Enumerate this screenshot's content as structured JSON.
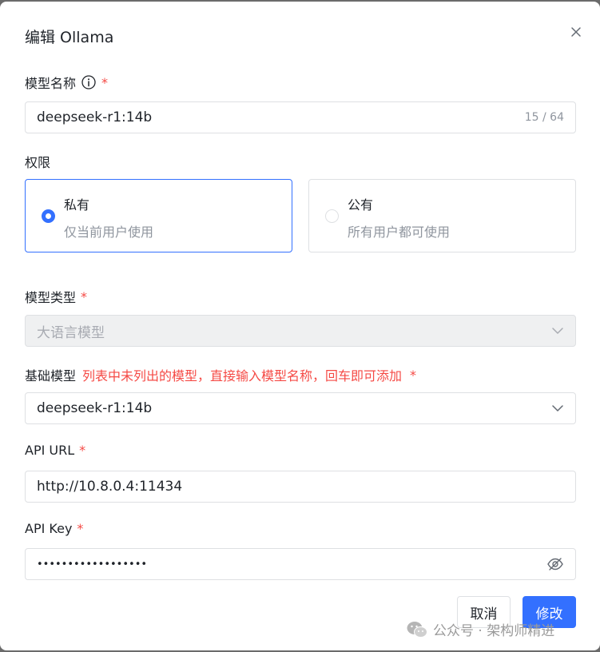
{
  "dialog": {
    "title": "编辑 Ollama"
  },
  "model_name": {
    "label": "模型名称",
    "required": "*",
    "value": "deepseek-r1:14b",
    "counter": "15 / 64"
  },
  "permission": {
    "label": "权限",
    "options": [
      {
        "title": "私有",
        "desc": "仅当前用户使用",
        "selected": true
      },
      {
        "title": "公有",
        "desc": "所有用户都可使用",
        "selected": false
      }
    ]
  },
  "model_type": {
    "label": "模型类型",
    "required": "*",
    "value": "大语言模型"
  },
  "base_model": {
    "label": "基础模型",
    "hint": "列表中未列出的模型，直接输入模型名称，回车即可添加",
    "required": "*",
    "value": "deepseek-r1:14b"
  },
  "api_url": {
    "label": "API URL",
    "required": "*",
    "value": "http://10.8.0.4:11434"
  },
  "api_key": {
    "label": "API Key",
    "required": "*",
    "masked_value": "••••••••••••••••••"
  },
  "buttons": {
    "cancel": "取消",
    "submit": "修改"
  },
  "watermark": {
    "text": "公众号 · 架构师精进"
  },
  "colors": {
    "primary": "#3370ff",
    "required": "#f54a45"
  }
}
